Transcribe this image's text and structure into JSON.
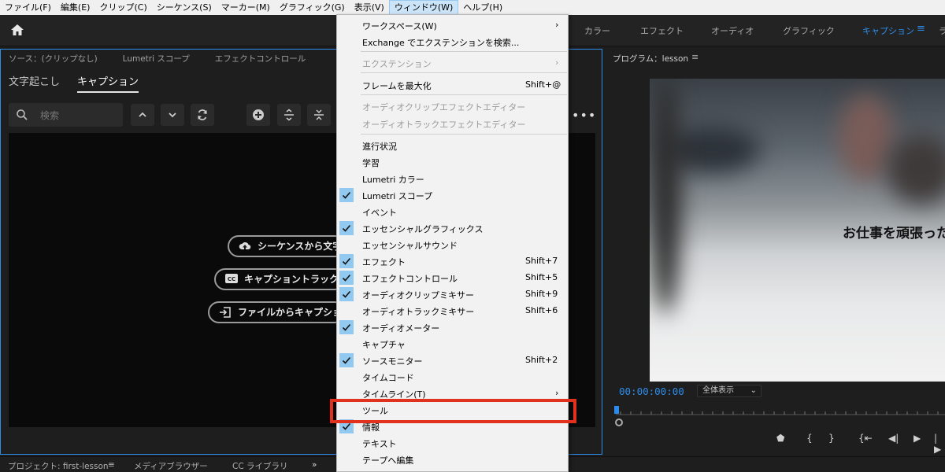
{
  "menubar": {
    "items": [
      "ファイル(F)",
      "編集(E)",
      "クリップ(C)",
      "シーケンス(S)",
      "マーカー(M)",
      "グラフィック(G)",
      "表示(V)",
      "ウィンドウ(W)",
      "ヘルプ(H)"
    ],
    "active_index": 7
  },
  "workspace_tabs": {
    "items": [
      "カラー",
      "エフェクト",
      "オーディオ",
      "グラフィック",
      "キャプション"
    ],
    "active": "キャプション",
    "overflow_glyph": "ラ"
  },
  "left_panel": {
    "tabs": [
      "ソース：(クリップなし)",
      "Lumetri スコープ",
      "エフェクトコントロール"
    ],
    "subtabs": [
      "文字起こし",
      "キャプション"
    ],
    "active_subtab": "キャプション",
    "search_placeholder": "検索",
    "actions": [
      "シーケンスから文字",
      "キャプショントラックを新",
      "ファイルからキャプションを"
    ]
  },
  "program": {
    "title": "プログラム：lesson",
    "caption_overlay": "お仕事を頑張った",
    "timecode": "00:00:00:00",
    "zoom": "全体表示"
  },
  "bottom_bar": {
    "tabs": [
      "プロジェクト: first-lesson",
      "メディアブラウザー",
      "CC ライブラリ"
    ],
    "overflow": "»"
  },
  "window_menu": {
    "items": [
      {
        "label": "ワークスペース(W)",
        "shortcut": "",
        "submenu": true,
        "checked": false,
        "disabled": false
      },
      {
        "label": "Exchange でエクステンションを検索...",
        "shortcut": "",
        "submenu": false,
        "checked": false,
        "disabled": false
      },
      {
        "label": "エクステンション",
        "shortcut": "",
        "submenu": true,
        "checked": false,
        "disabled": true
      },
      {
        "label": "フレームを最大化",
        "shortcut": "Shift+@",
        "submenu": false,
        "checked": false,
        "disabled": false
      },
      {
        "label": "オーディオクリップエフェクトエディター",
        "shortcut": "",
        "submenu": false,
        "checked": false,
        "disabled": true
      },
      {
        "label": "オーディオトラックエフェクトエディター",
        "shortcut": "",
        "submenu": false,
        "checked": false,
        "disabled": true
      },
      {
        "label": "進行状況",
        "shortcut": "",
        "submenu": false,
        "checked": false,
        "disabled": false
      },
      {
        "label": "学習",
        "shortcut": "",
        "submenu": false,
        "checked": false,
        "disabled": false
      },
      {
        "label": "Lumetri カラー",
        "shortcut": "",
        "submenu": false,
        "checked": false,
        "disabled": false
      },
      {
        "label": "Lumetri スコープ",
        "shortcut": "",
        "submenu": false,
        "checked": true,
        "disabled": false
      },
      {
        "label": "イベント",
        "shortcut": "",
        "submenu": false,
        "checked": false,
        "disabled": false
      },
      {
        "label": "エッセンシャルグラフィックス",
        "shortcut": "",
        "submenu": false,
        "checked": true,
        "disabled": false
      },
      {
        "label": "エッセンシャルサウンド",
        "shortcut": "",
        "submenu": false,
        "checked": false,
        "disabled": false
      },
      {
        "label": "エフェクト",
        "shortcut": "Shift+7",
        "submenu": false,
        "checked": true,
        "disabled": false
      },
      {
        "label": "エフェクトコントロール",
        "shortcut": "Shift+5",
        "submenu": false,
        "checked": true,
        "disabled": false
      },
      {
        "label": "オーディオクリップミキサー",
        "shortcut": "Shift+9",
        "submenu": false,
        "checked": true,
        "disabled": false
      },
      {
        "label": "オーディオトラックミキサー",
        "shortcut": "Shift+6",
        "submenu": false,
        "checked": false,
        "disabled": false
      },
      {
        "label": "オーディオメーター",
        "shortcut": "",
        "submenu": false,
        "checked": true,
        "disabled": false
      },
      {
        "label": "キャプチャ",
        "shortcut": "",
        "submenu": false,
        "checked": false,
        "disabled": false
      },
      {
        "label": "ソースモニター",
        "shortcut": "Shift+2",
        "submenu": false,
        "checked": true,
        "disabled": false
      },
      {
        "label": "タイムコード",
        "shortcut": "",
        "submenu": false,
        "checked": false,
        "disabled": false
      },
      {
        "label": "タイムライン(T)",
        "shortcut": "",
        "submenu": true,
        "checked": false,
        "disabled": false
      },
      {
        "label": "ツール",
        "shortcut": "",
        "submenu": false,
        "checked": false,
        "disabled": false,
        "highlighted": true
      },
      {
        "label": "情報",
        "shortcut": "",
        "submenu": false,
        "checked": true,
        "disabled": false
      },
      {
        "label": "テキスト",
        "shortcut": "",
        "submenu": false,
        "checked": false,
        "disabled": false
      },
      {
        "label": "テープへ編集",
        "shortcut": "",
        "submenu": false,
        "checked": false,
        "disabled": false
      }
    ]
  },
  "colors": {
    "accent_blue": "#2d8ceb",
    "check_bg": "#92c9f0",
    "highlight_red": "#e0321e",
    "menu_bg": "#f2f2f2"
  }
}
